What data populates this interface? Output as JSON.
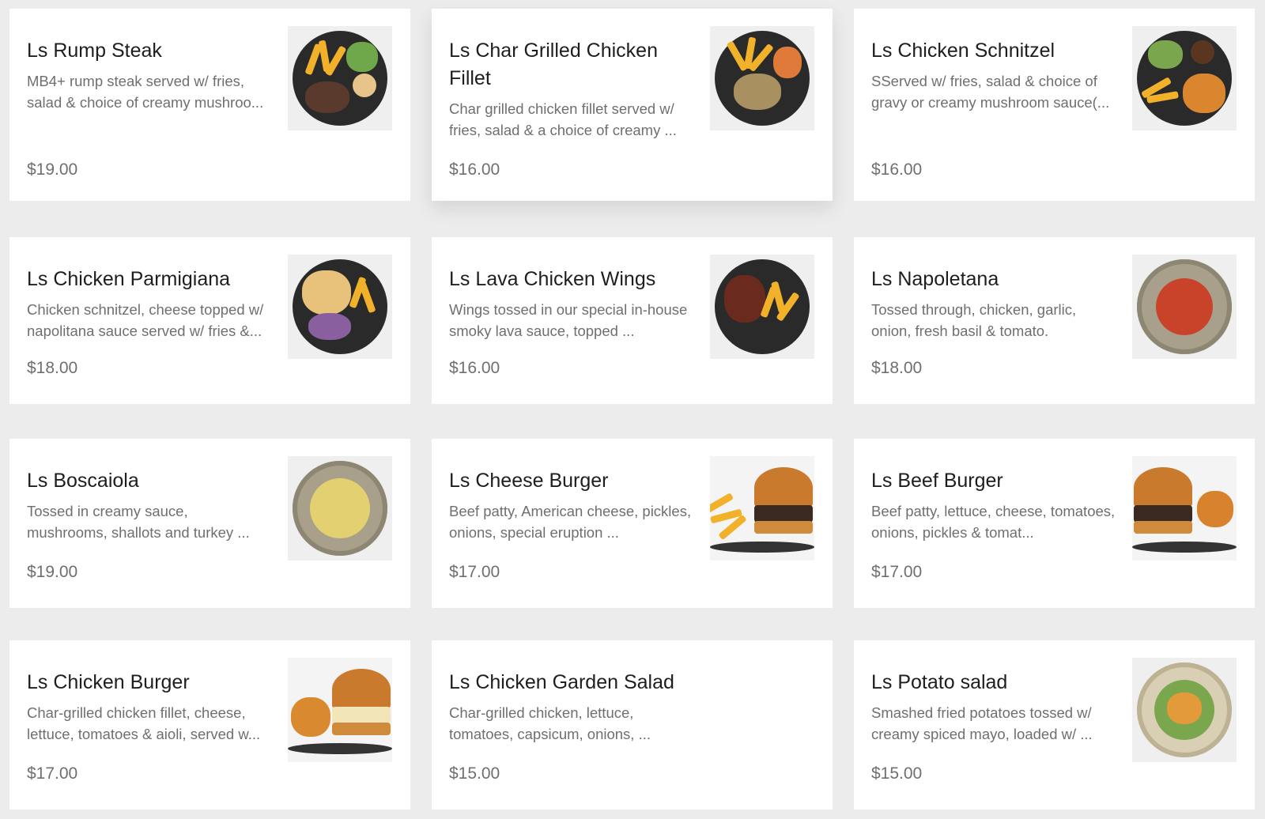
{
  "menu": {
    "items": [
      {
        "name": "Ls Rump Steak",
        "description": "MB4+ rump steak served w/ fries, salad & choice of creamy mushroo...",
        "price": "$19.00",
        "image": "steak-plate-image"
      },
      {
        "name": "Ls Char Grilled Chicken Fillet",
        "description": "Char grilled chicken fillet served w/ fries, salad & a choice of creamy ...",
        "price": "$16.00",
        "image": "chicken-fillet-plate-image"
      },
      {
        "name": "Ls Chicken Schnitzel",
        "description": "SServed w/ fries, salad & choice of gravy or creamy mushroom sauce(...",
        "price": "$16.00",
        "image": "schnitzel-plate-image"
      },
      {
        "name": "Ls Chicken Parmigiana",
        "description": "Chicken schnitzel, cheese topped w/ napolitana sauce served w/ fries &...",
        "price": "$18.00",
        "image": "parmigiana-plate-image"
      },
      {
        "name": "Ls Lava Chicken Wings",
        "description": "Wings tossed in our special in-house smoky lava sauce, topped ...",
        "price": "$16.00",
        "image": "chicken-wings-plate-image"
      },
      {
        "name": "Ls Napoletana",
        "description": "Tossed through, chicken, garlic, onion, fresh basil & tomato.",
        "price": "$18.00",
        "image": "napoletana-bowl-image"
      },
      {
        "name": "Ls Boscaiola",
        "description": "Tossed in creamy sauce, mushrooms, shallots and turkey ...",
        "price": "$19.00",
        "image": "boscaiola-bowl-image"
      },
      {
        "name": "Ls Cheese Burger",
        "description": "Beef patty, American cheese, pickles, onions, special eruption ...",
        "price": "$17.00",
        "image": "cheese-burger-image"
      },
      {
        "name": "Ls Beef Burger",
        "description": "Beef patty, lettuce, cheese, tomatoes, onions, pickles & tomat...",
        "price": "$17.00",
        "image": "beef-burger-image"
      },
      {
        "name": "Ls Chicken Burger",
        "description": "Char-grilled chicken fillet, cheese, lettuce, tomatoes & aioli, served w...",
        "price": "$17.00",
        "image": "chicken-burger-image"
      },
      {
        "name": "Ls Chicken Garden Salad",
        "description": "Char-grilled chicken, lettuce, tomatoes, capsicum, onions, ...",
        "price": "$15.00",
        "image": ""
      },
      {
        "name": "Ls Potato salad",
        "description": "Smashed fried potatoes tossed w/ creamy spiced mayo, loaded w/ ...",
        "price": "$15.00",
        "image": "potato-salad-bowl-image"
      }
    ]
  }
}
